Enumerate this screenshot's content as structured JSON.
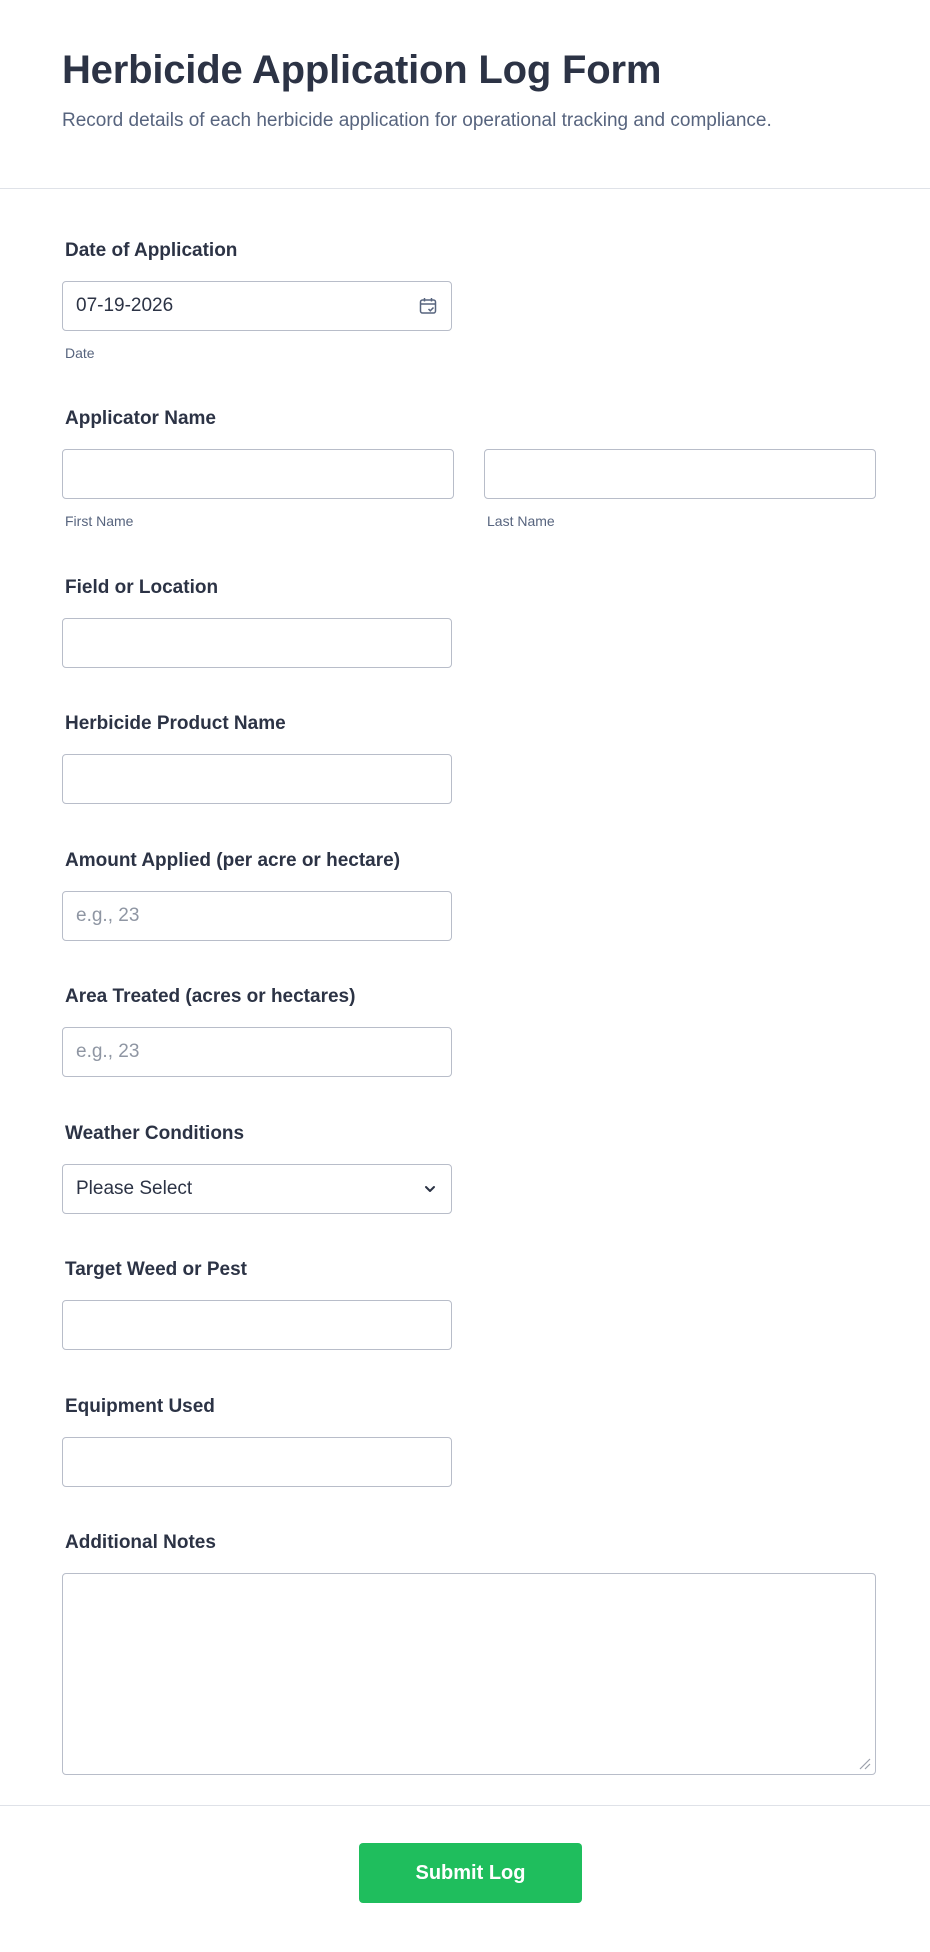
{
  "header": {
    "title": "Herbicide Application Log Form",
    "subtitle": "Record details of each herbicide application for operational tracking and compliance."
  },
  "fields": {
    "date": {
      "label": "Date of Application",
      "value": "07-19-2026",
      "sublabel": "Date",
      "icon": "calendar-icon"
    },
    "applicator": {
      "label": "Applicator Name",
      "first_sublabel": "First Name",
      "last_sublabel": "Last Name",
      "first_value": "",
      "last_value": ""
    },
    "location": {
      "label": "Field or Location",
      "value": ""
    },
    "product": {
      "label": "Herbicide Product Name",
      "value": ""
    },
    "amount": {
      "label": "Amount Applied (per acre or hectare)",
      "placeholder": "e.g., 23",
      "value": ""
    },
    "area": {
      "label": "Area Treated (acres or hectares)",
      "placeholder": "e.g., 23",
      "value": ""
    },
    "weather": {
      "label": "Weather Conditions",
      "selected": "Please Select",
      "icon": "chevron-down-icon"
    },
    "target": {
      "label": "Target Weed or Pest",
      "value": ""
    },
    "equipment": {
      "label": "Equipment Used",
      "value": ""
    },
    "notes": {
      "label": "Additional Notes",
      "value": ""
    }
  },
  "submit": {
    "label": "Submit Log",
    "color": "#1fbe5d"
  },
  "colors": {
    "text": "#2c3345",
    "muted": "#57647e",
    "border": "#b8bdc9",
    "divider": "#dfe2e8",
    "placeholder": "#8f96a3"
  }
}
